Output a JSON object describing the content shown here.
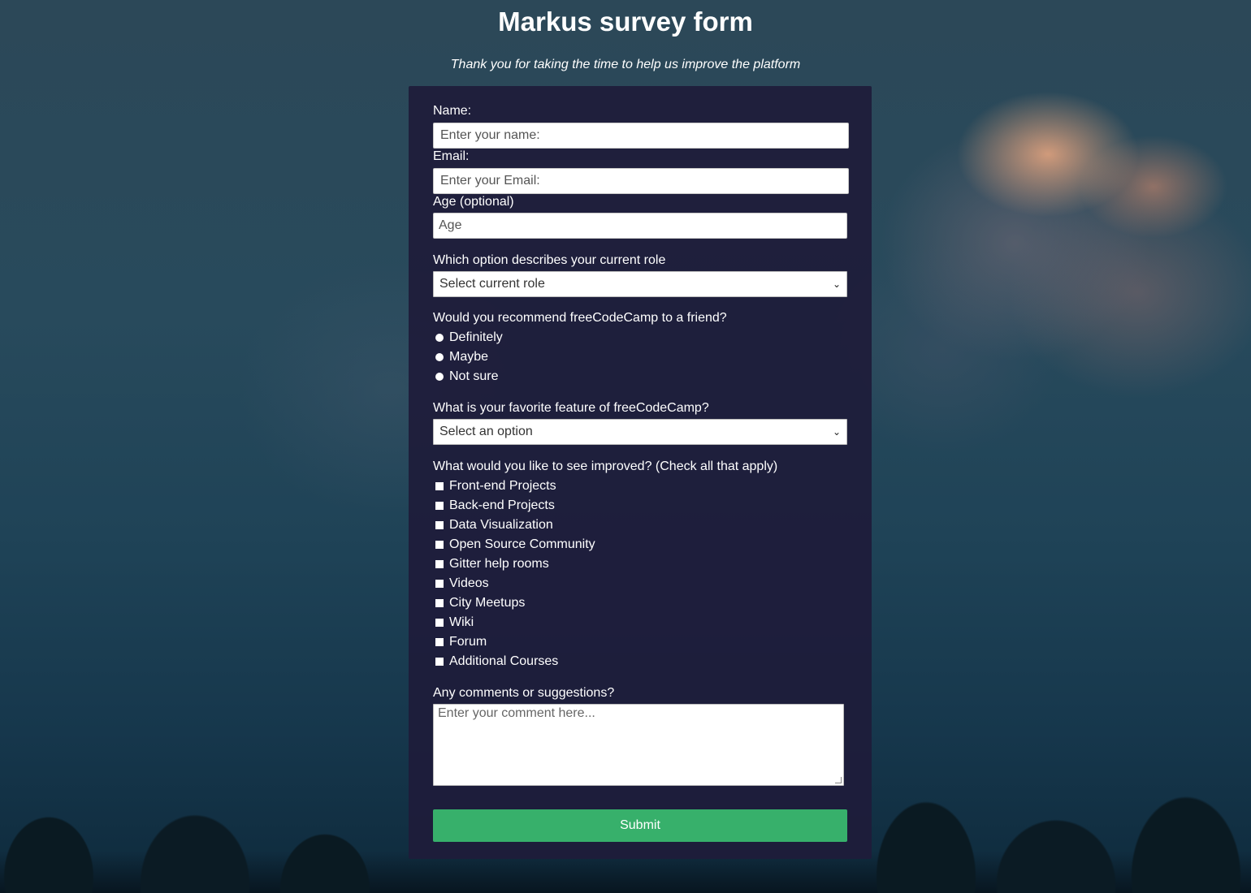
{
  "header": {
    "title": "Markus survey form",
    "description": "Thank you for taking the time to help us improve the platform"
  },
  "form": {
    "name_label": "Name:",
    "name_placeholder": "Enter your name:",
    "email_label": "Email:",
    "email_placeholder": "Enter your Email:",
    "age_label": "Age (optional)",
    "age_placeholder": "Age",
    "role_label": "Which option describes your current role",
    "role_selected": "Select current role",
    "recommend_label": "Would you recommend freeCodeCamp to a friend?",
    "recommend_options": [
      "Definitely",
      "Maybe",
      "Not sure"
    ],
    "feature_label": "What is your favorite feature of freeCodeCamp?",
    "feature_selected": "Select an option",
    "improve_label": "What would you like to see improved? (Check all that apply)",
    "improve_options": [
      "Front-end Projects",
      "Back-end Projects",
      "Data Visualization",
      "Open Source Community",
      "Gitter help rooms",
      "Videos",
      "City Meetups",
      "Wiki",
      "Forum",
      "Additional Courses"
    ],
    "comments_label": "Any comments or suggestions?",
    "comments_placeholder": "Enter your comment here...",
    "submit_label": "Submit"
  },
  "icons": {
    "dropdown": "chevron-down-icon"
  },
  "colors": {
    "submit_background": "#37b06b",
    "form_background": "#1e1c3a"
  }
}
